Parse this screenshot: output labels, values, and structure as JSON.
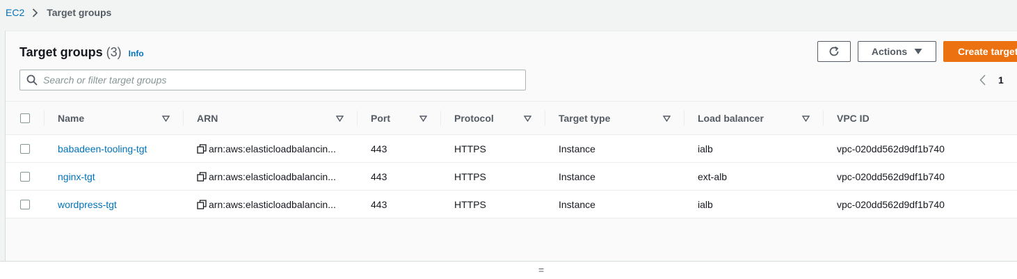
{
  "breadcrumb": {
    "root": "EC2",
    "current": "Target groups"
  },
  "header": {
    "title": "Target groups",
    "count": "(3)",
    "info": "Info"
  },
  "toolbar": {
    "actions_label": "Actions",
    "create_label": "Create target"
  },
  "search": {
    "placeholder": "Search or filter target groups"
  },
  "pagination": {
    "current_page": "1"
  },
  "table": {
    "columns": [
      "Name",
      "ARN",
      "Port",
      "Protocol",
      "Target type",
      "Load balancer",
      "VPC ID"
    ],
    "rows": [
      {
        "name": "babadeen-tooling-tgt",
        "arn": "arn:aws:elasticloadbalancin...",
        "port": "443",
        "protocol": "HTTPS",
        "target_type": "Instance",
        "load_balancer": "ialb",
        "vpc_id": "vpc-020dd562d9df1b740"
      },
      {
        "name": "nginx-tgt",
        "arn": "arn:aws:elasticloadbalancin...",
        "port": "443",
        "protocol": "HTTPS",
        "target_type": "Instance",
        "load_balancer": "ext-alb",
        "vpc_id": "vpc-020dd562d9df1b740"
      },
      {
        "name": "wordpress-tgt",
        "arn": "arn:aws:elasticloadbalancin...",
        "port": "443",
        "protocol": "HTTPS",
        "target_type": "Instance",
        "load_balancer": "ialb",
        "vpc_id": "vpc-020dd562d9df1b740"
      }
    ]
  },
  "splitter": {
    "grip": "="
  },
  "icons": {
    "breadcrumb_separator": "chevron-right-icon",
    "refresh": "refresh-icon",
    "actions_caret": "caret-down-icon",
    "search": "search-icon",
    "prev_page": "chevron-left-icon",
    "sort": "sort-triangle-icon",
    "copy": "copy-icon"
  },
  "colors": {
    "link": "#0073bb",
    "primary": "#ec7211",
    "text": "#16191f",
    "muted": "#545b64",
    "page_bg": "#f2f3f3"
  }
}
